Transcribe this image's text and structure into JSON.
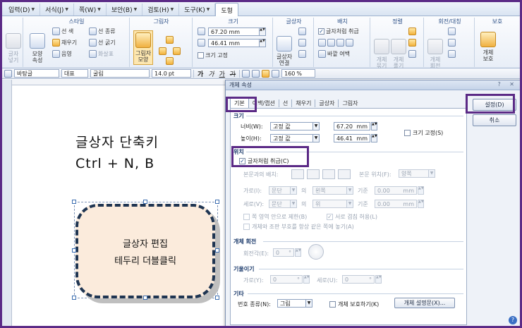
{
  "menu": {
    "tabs": [
      {
        "label": "입력(D)",
        "dd": true
      },
      {
        "label": "서식(J)",
        "dd": true
      },
      {
        "label": "쪽(W)",
        "dd": true
      },
      {
        "label": "보안(B)",
        "dd": true
      },
      {
        "label": "검토(H)",
        "dd": true
      },
      {
        "label": "도구(K)",
        "dd": true
      },
      {
        "label": "도형",
        "dd": false
      }
    ]
  },
  "ribbon": {
    "groups": {
      "style": "스타일",
      "shadow": "그림자",
      "size": "크기",
      "textbox": "글상자",
      "layout": "배치",
      "align": "정렬",
      "rotate": "회전/대칭",
      "protect": "보호"
    },
    "textbox_link": "글자\n넣기",
    "shape_style": "모양\n속성",
    "line_color": "선 색",
    "line_kind": "선 종류",
    "fill": "채우기",
    "line_width": "선 굵기",
    "shadow_style": "음영",
    "pattern": "화살표",
    "shadow_btn": "그림자\n모양",
    "width_value": "67.20",
    "height_value": "46.41",
    "unit": "mm",
    "size_lock": "크기 고정",
    "textbox_btn": "글상자\n연결",
    "treat_as_char": "글자처럼 취급",
    "outside_margin": "바깥 여백",
    "group_obj": "개체\n묶기",
    "ungroup_obj": "개체\n풀기",
    "rotate_btn": "개체\n회전",
    "protect_btn": "개체\n보호"
  },
  "format_bar": {
    "style": "바탕글",
    "lang": "대표",
    "font": "굴림",
    "size": "14.0",
    "size_unit": "pt",
    "bold": "가",
    "italic": "가",
    "underline": "가",
    "strike": "가",
    "zoom": "160",
    "zoom_unit": "%"
  },
  "document": {
    "line1": "글상자 단축키",
    "line2": "Ctrl + N, B",
    "shape_line1": "글상자 편집",
    "shape_line2": "테두리 더블클릭"
  },
  "dialog": {
    "title": "개체 속성",
    "title_controls": "? ✕",
    "tabs": [
      "기본",
      "여백/캡션",
      "선",
      "채우기",
      "글상자",
      "그림자"
    ],
    "ok": "설정(D)",
    "cancel": "취소",
    "size_section": "크기",
    "width_label": "너비(W):",
    "width_mode": "고정 값",
    "width_value": "67.20",
    "height_label": "높이(H):",
    "height_mode": "고정 값",
    "height_value": "46.41",
    "unit": "mm",
    "size_lock": "크기 고정(S)",
    "position_section": "위치",
    "treat_as_char": "글자처럼 취급(C)",
    "wrap_label": "본문과의 배치:",
    "body_pos_label": "본문 위치(F):",
    "body_pos_value": "양쪽",
    "horiz_label": "가로(I):",
    "horiz_ref": "문단",
    "horiz_of": "의",
    "horiz_align": "왼쪽",
    "horiz_base": "기준",
    "horiz_value": "0.00",
    "vert_label": "세로(V):",
    "vert_ref": "문단",
    "vert_of": "의",
    "vert_align": "위",
    "vert_base": "기준",
    "vert_value": "0.00",
    "restrict_page": "쪽 영역 안으로 제한(B)",
    "allow_overlap": "서로 겹침 허용(L)",
    "keep_with_anchor": "개체와 조판 부호를 항상 같은 쪽에 놓기(A)",
    "rotate_section": "개체 회전",
    "rotate_label": "회전각(E):",
    "rotate_value": "0",
    "rotate_unit": "°",
    "skew_section": "기울이기",
    "skew_h_label": "가로(Y):",
    "skew_h_value": "0",
    "skew_v_label": "세로(U):",
    "skew_v_value": "0",
    "misc_section": "기타",
    "number_type_label": "번호 종류(N):",
    "number_type_value": "그림",
    "protect_obj": "개체 보호하기(K)",
    "obj_desc_btn": "개체 설명문(X)..."
  },
  "colors": {
    "highlight": "#5b2a86",
    "shape_fill": "#fbebdc",
    "shape_border": "#1f3552"
  }
}
